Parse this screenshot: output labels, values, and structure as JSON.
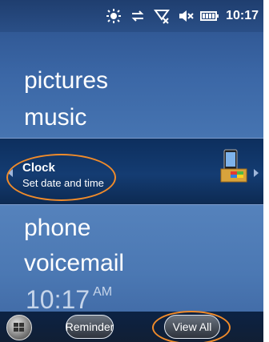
{
  "status": {
    "time": "10:17",
    "icons": [
      "brightness-icon",
      "sync-icon",
      "signal-off-icon",
      "volume-off-icon",
      "battery-icon"
    ]
  },
  "menu": {
    "items": [
      "pictures",
      "music",
      "phone",
      "voicemail"
    ]
  },
  "band": {
    "title": "Clock",
    "subtitle": "Set date and time",
    "icon": "windows-flag-icon"
  },
  "home_clock": {
    "time": "10:17",
    "ampm": "AM"
  },
  "softkeys": {
    "start_icon": "windows-flag-icon",
    "reminder": "Reminder",
    "view_all": "View All"
  },
  "colors": {
    "highlight": "#f08b2a",
    "background": "#4674b1"
  }
}
